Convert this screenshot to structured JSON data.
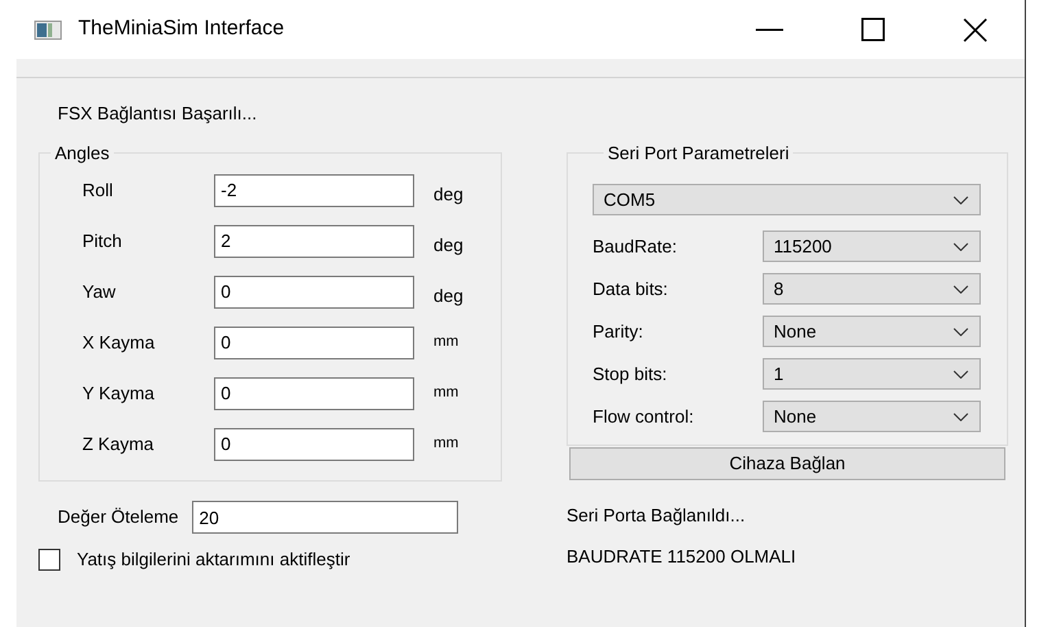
{
  "window": {
    "title": "TheMiniaSim Interface"
  },
  "status_top": "FSX Bağlantısı Başarılı...",
  "angles": {
    "title": "Angles",
    "rows": [
      {
        "label": "Roll",
        "value": "-2",
        "unit": "deg"
      },
      {
        "label": "Pitch",
        "value": "2",
        "unit": "deg"
      },
      {
        "label": "Yaw",
        "value": "0",
        "unit": "deg"
      },
      {
        "label": "X Kayma",
        "value": "0",
        "unit": "mm"
      },
      {
        "label": "Y Kayma",
        "value": "0",
        "unit": "mm"
      },
      {
        "label": "Z Kayma",
        "value": "0",
        "unit": "mm"
      }
    ]
  },
  "offset": {
    "label": "Değer Öteleme",
    "value": "20"
  },
  "checkbox": {
    "label": "Yatış bilgilerini aktarımını aktifleştir",
    "checked": false
  },
  "serial": {
    "title": "Seri Port Parametreleri",
    "port": "COM5",
    "params": [
      {
        "label": "BaudRate:",
        "value": "115200"
      },
      {
        "label": "Data bits:",
        "value": "8"
      },
      {
        "label": "Parity:",
        "value": "None"
      },
      {
        "label": "Stop bits:",
        "value": "1"
      },
      {
        "label": "Flow control:",
        "value": "None"
      }
    ],
    "button": "Cihaza Bağlan"
  },
  "messages": [
    "Seri Porta Bağlanıldı...",
    "BAUDRATE 115200 OLMALI"
  ]
}
